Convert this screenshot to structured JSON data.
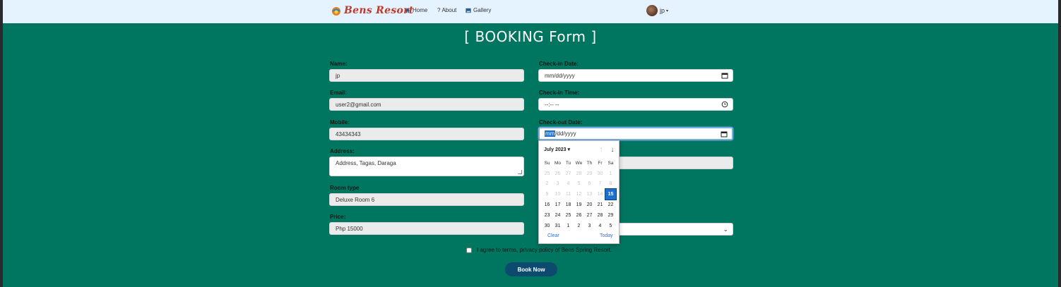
{
  "navbar": {
    "brand": "Bens Resort",
    "links": [
      {
        "label": "Home",
        "icon": "home-icon"
      },
      {
        "label": "About",
        "icon": "question-icon"
      },
      {
        "label": "Gallery",
        "icon": "image-icon"
      }
    ],
    "user": "jp"
  },
  "form": {
    "title": "[ BOOKING Form ]",
    "name": {
      "label": "Name:",
      "value": "jp"
    },
    "email": {
      "label": "Email:",
      "value": "user2@gmail.com"
    },
    "mobile": {
      "label": "Mobile:",
      "value": "43434343"
    },
    "address": {
      "label": "Address:",
      "value": "Address, Tagas, Daraga"
    },
    "room_type": {
      "label": "Room type",
      "value": "Deluxe Room 6"
    },
    "price": {
      "label": "Price:",
      "value": "Php 15000"
    },
    "checkin_date": {
      "label": "Check-in Date:",
      "placeholder": "mm/dd/yyyy"
    },
    "checkin_time": {
      "label": "Check-in Time:",
      "placeholder": "--:-- --"
    },
    "checkout_date": {
      "label": "Check-out Date:",
      "placeholder_selected": "mm",
      "placeholder_rest": "/dd/yyyy"
    },
    "terms": "I agree to terms, privacy policy of Bens Spring Resort.",
    "submit": "Book Now"
  },
  "calendar": {
    "month": "July 2023",
    "weekdays": [
      "Su",
      "Mo",
      "Tu",
      "We",
      "Th",
      "Fr",
      "Sa"
    ],
    "weeks": [
      [
        {
          "d": "25",
          "s": "dim"
        },
        {
          "d": "26",
          "s": "dim"
        },
        {
          "d": "27",
          "s": "dim"
        },
        {
          "d": "28",
          "s": "dim"
        },
        {
          "d": "29",
          "s": "dim"
        },
        {
          "d": "30",
          "s": "dim"
        },
        {
          "d": "1",
          "s": "dim"
        }
      ],
      [
        {
          "d": "2",
          "s": "dim"
        },
        {
          "d": "3",
          "s": "dim"
        },
        {
          "d": "4",
          "s": "dim"
        },
        {
          "d": "5",
          "s": "dim"
        },
        {
          "d": "6",
          "s": "dim"
        },
        {
          "d": "7",
          "s": "dim"
        },
        {
          "d": "8",
          "s": "dim"
        }
      ],
      [
        {
          "d": "9",
          "s": "dim"
        },
        {
          "d": "10",
          "s": "dim"
        },
        {
          "d": "11",
          "s": "dim"
        },
        {
          "d": "12",
          "s": "dim"
        },
        {
          "d": "13",
          "s": "dim"
        },
        {
          "d": "14",
          "s": "dim"
        },
        {
          "d": "15",
          "s": "sel"
        }
      ],
      [
        {
          "d": "16",
          "s": ""
        },
        {
          "d": "17",
          "s": ""
        },
        {
          "d": "18",
          "s": ""
        },
        {
          "d": "19",
          "s": ""
        },
        {
          "d": "20",
          "s": ""
        },
        {
          "d": "21",
          "s": ""
        },
        {
          "d": "22",
          "s": ""
        }
      ],
      [
        {
          "d": "23",
          "s": ""
        },
        {
          "d": "24",
          "s": ""
        },
        {
          "d": "25",
          "s": ""
        },
        {
          "d": "26",
          "s": ""
        },
        {
          "d": "27",
          "s": ""
        },
        {
          "d": "28",
          "s": ""
        },
        {
          "d": "29",
          "s": ""
        }
      ],
      [
        {
          "d": "30",
          "s": ""
        },
        {
          "d": "31",
          "s": ""
        },
        {
          "d": "1",
          "s": ""
        },
        {
          "d": "2",
          "s": ""
        },
        {
          "d": "3",
          "s": ""
        },
        {
          "d": "4",
          "s": ""
        },
        {
          "d": "5",
          "s": ""
        }
      ]
    ],
    "clear": "Clear",
    "today": "Today"
  },
  "colors": {
    "page_bg": "#007560",
    "navbar_bg": "#e5f2ff",
    "button": "#0c4b6e",
    "selected_day": "#1f6fd0"
  }
}
